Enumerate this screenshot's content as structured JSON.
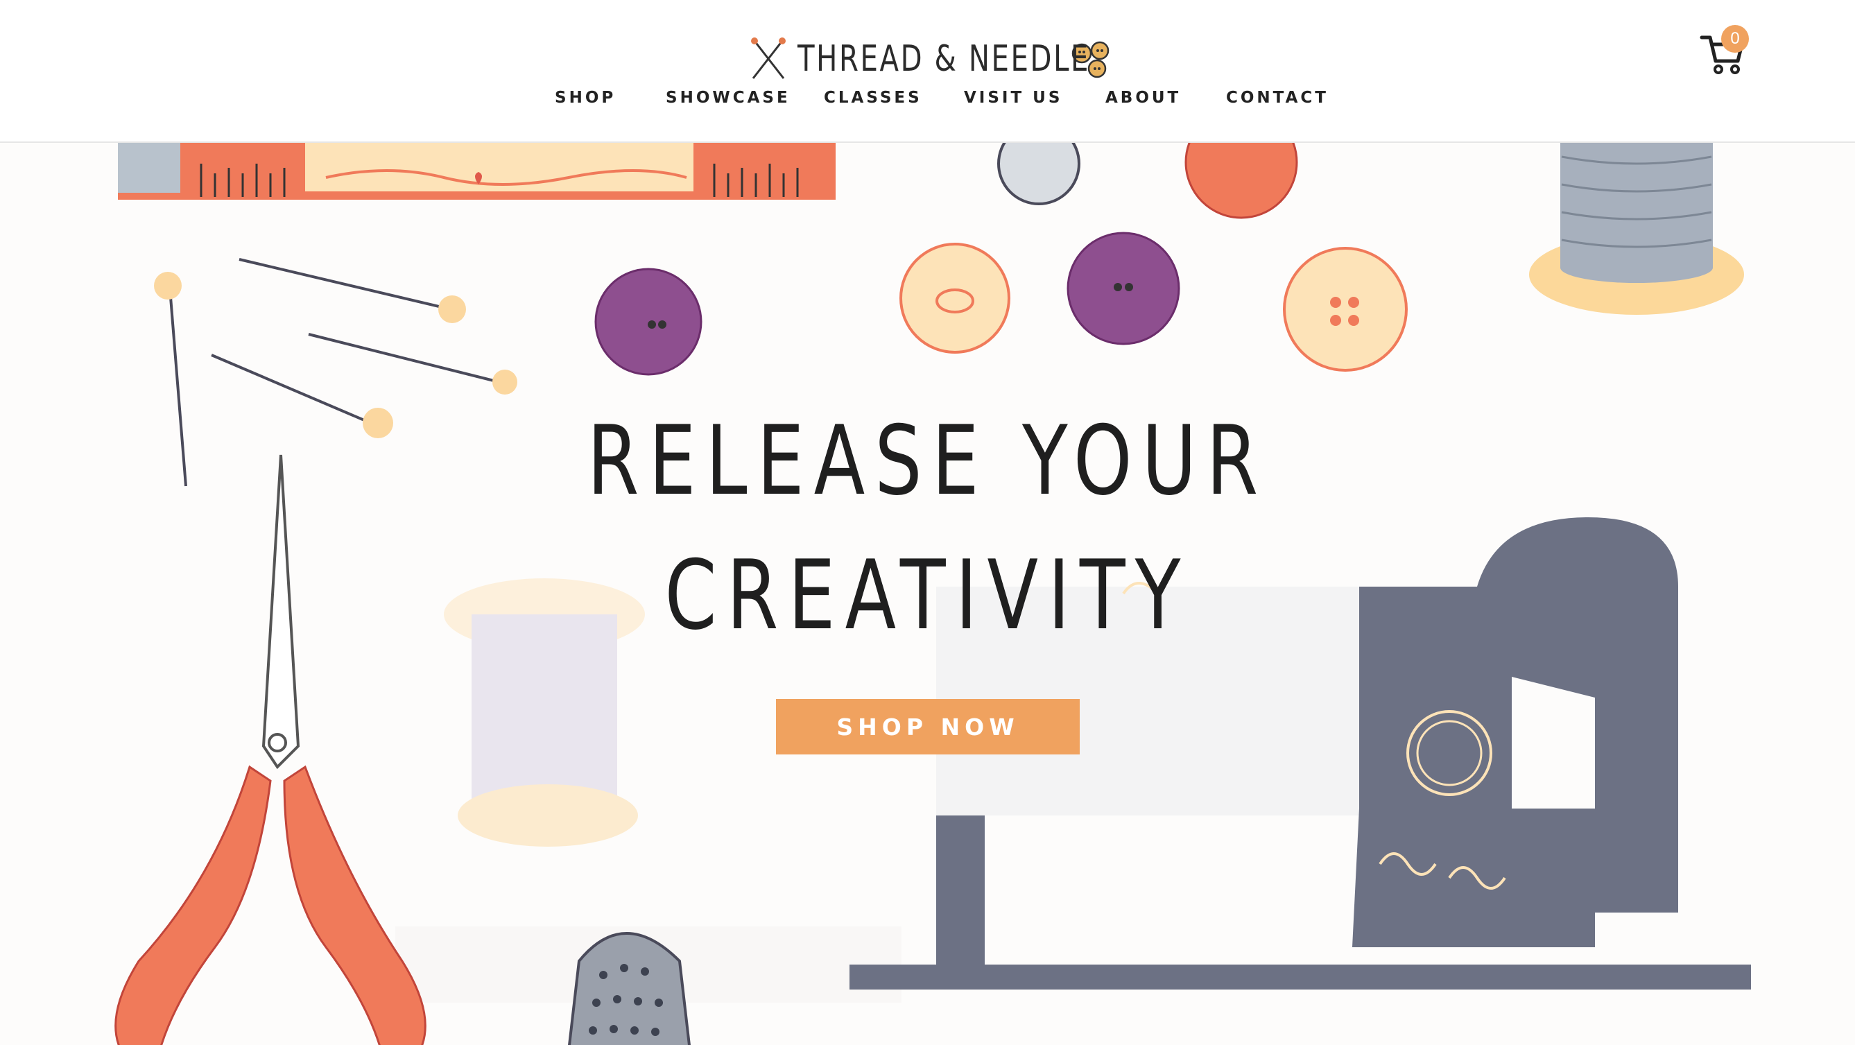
{
  "brand": {
    "name": "THREAD & NEEDLE",
    "accent_color": "#f0a25f",
    "logo_left_icon": "crossed-needles-icon",
    "logo_right_icon": "buttons-icon"
  },
  "nav": {
    "items": [
      {
        "label": "SHOP"
      },
      {
        "label": "SHOWCASE"
      },
      {
        "label": "CLASSES"
      },
      {
        "label": "VISIT US"
      },
      {
        "label": "ABOUT"
      },
      {
        "label": "CONTACT"
      }
    ]
  },
  "cart": {
    "icon": "cart-icon",
    "count": "0"
  },
  "hero": {
    "title_line1": "RELEASE YOUR",
    "title_line2": "CREATIVITY",
    "cta_label": "SHOP NOW",
    "background": "sewing-notions-illustration"
  }
}
